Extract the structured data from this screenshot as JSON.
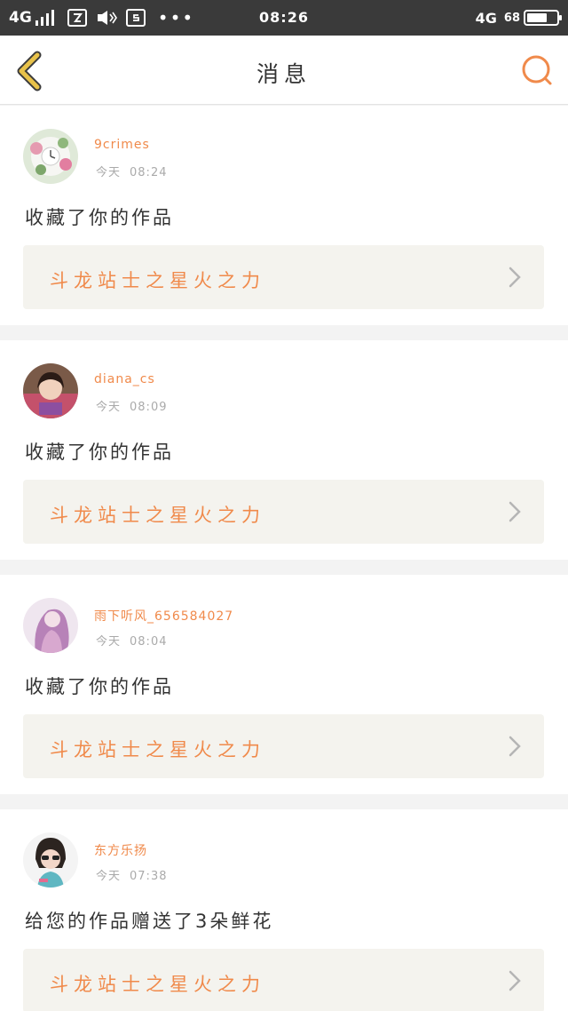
{
  "status_bar": {
    "network": "4G",
    "time": "08:26",
    "network_right": "4G",
    "battery_percent": "68",
    "battery_level": 0.68
  },
  "header": {
    "title": "消息",
    "back_icon": "chevron-left-icon",
    "search_icon": "search-icon"
  },
  "colors": {
    "accent": "#f08a4b",
    "back_icon": "#e8c24a",
    "card_link_bg": "#f4f3ee",
    "status_bar_bg": "#3a3a3a"
  },
  "messages": [
    {
      "username": "9crimes",
      "day": "今天",
      "time": "08:24",
      "action": "收藏了你的作品",
      "work_title": "斗龙站士之星火之力"
    },
    {
      "username": "diana_cs",
      "day": "今天",
      "time": "08:09",
      "action": "收藏了你的作品",
      "work_title": "斗龙站士之星火之力"
    },
    {
      "username": "雨下听风_656584027",
      "day": "今天",
      "time": "08:04",
      "action": "收藏了你的作品",
      "work_title": "斗龙站士之星火之力"
    },
    {
      "username": "东方乐扬",
      "day": "今天",
      "time": "07:38",
      "action": "给您的作品赠送了3朵鲜花",
      "work_title": "斗龙站士之星火之力"
    }
  ]
}
